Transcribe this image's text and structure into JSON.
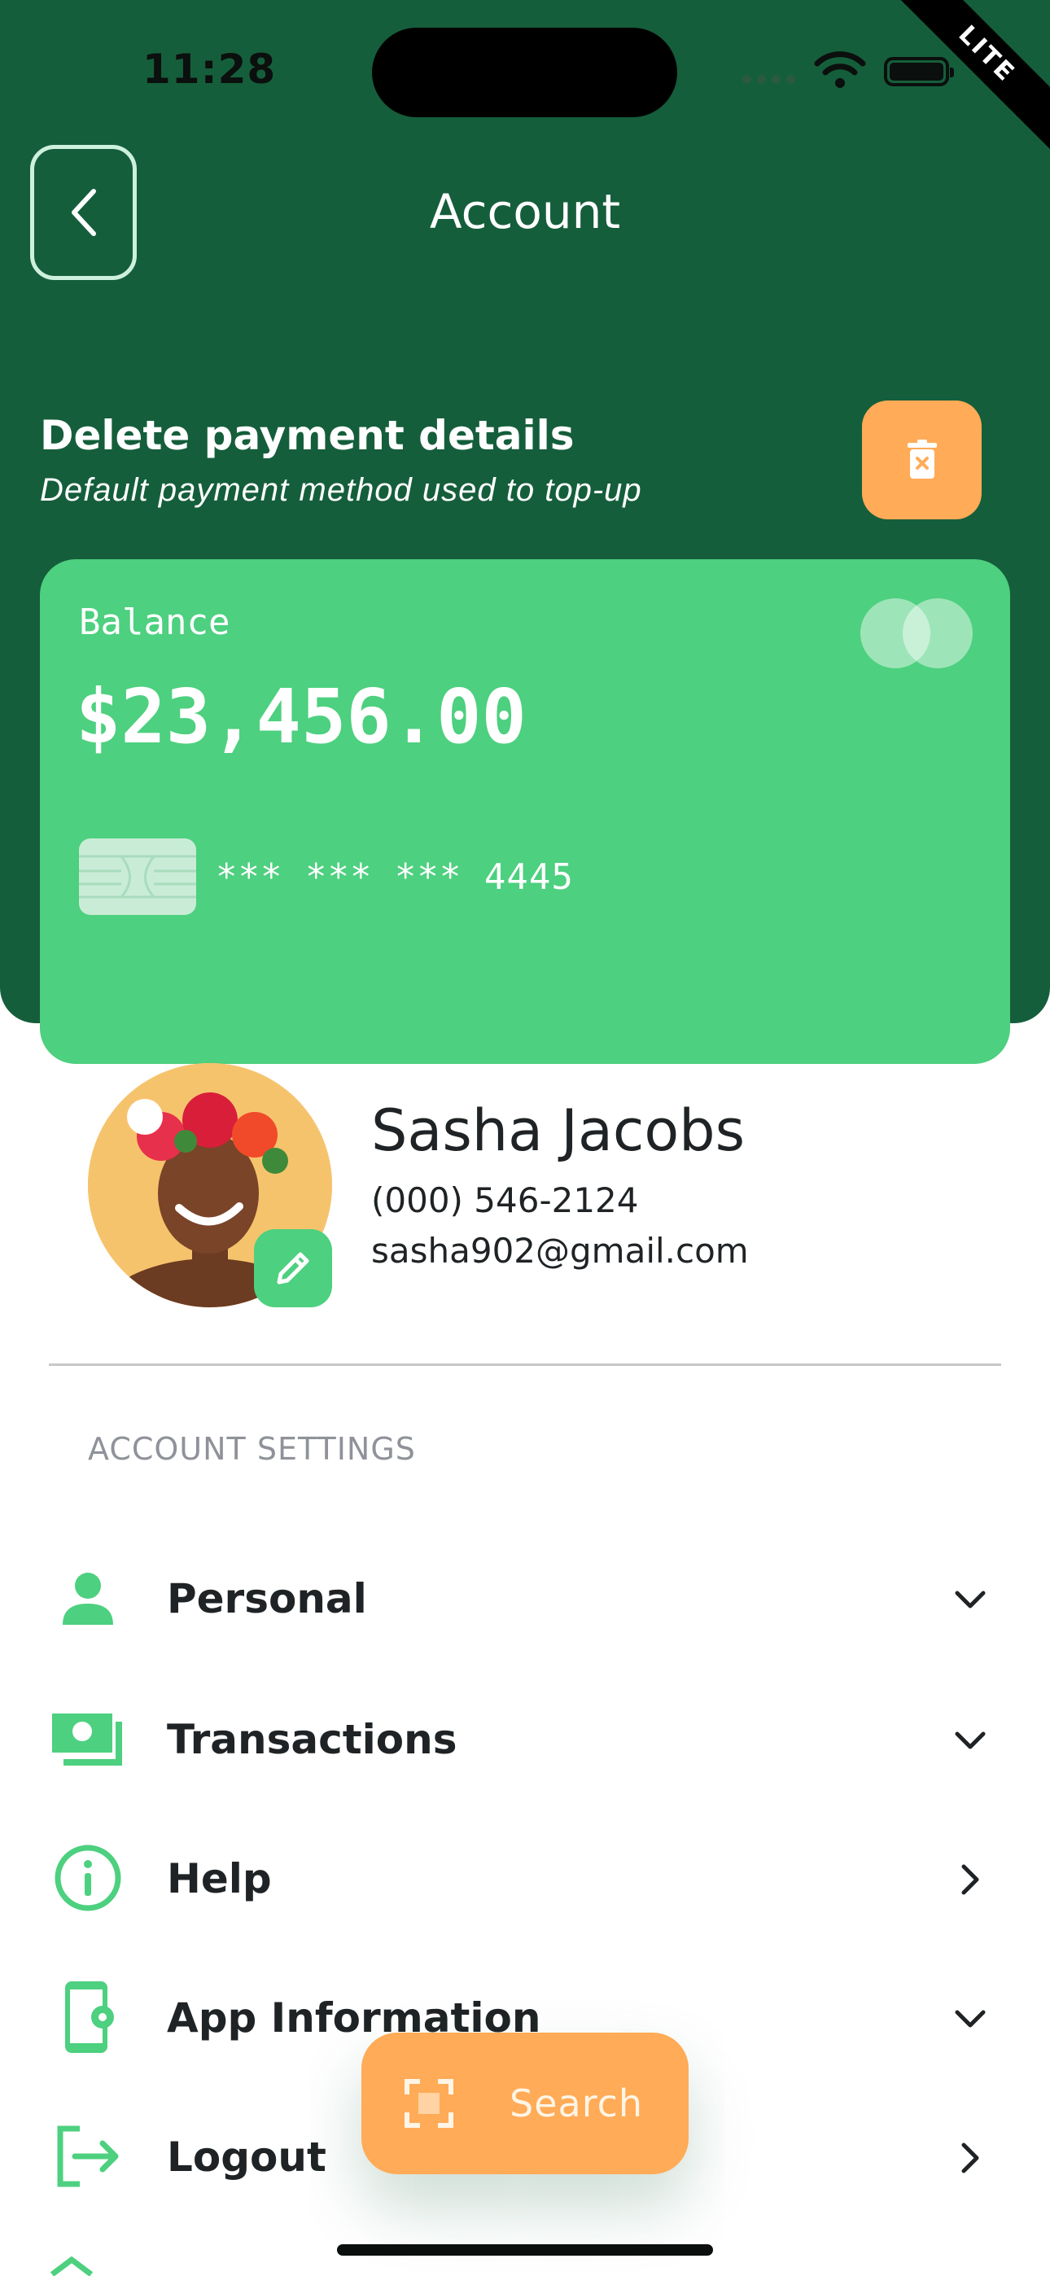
{
  "status_bar": {
    "time": "11:28"
  },
  "badge": {
    "label": "LITE"
  },
  "header": {
    "title": "Account"
  },
  "payment": {
    "title": "Delete payment details",
    "subtitle": "Default payment method used to top-up"
  },
  "card": {
    "balance_label": "Balance",
    "balance_value": "$23,456.00",
    "masked_number": "*** *** *** 4445"
  },
  "profile": {
    "name": "Sasha Jacobs",
    "phone": "(000) 546-2124",
    "email": "sasha902@gmail.com"
  },
  "settings": {
    "section_label": "ACCOUNT SETTINGS",
    "items": [
      {
        "label": "Personal",
        "icon": "person-icon",
        "chevron": "chevron-down-icon"
      },
      {
        "label": "Transactions",
        "icon": "money-icon",
        "chevron": "chevron-down-icon"
      },
      {
        "label": "Help",
        "icon": "info-icon",
        "chevron": "chevron-right-icon"
      },
      {
        "label": "App Information",
        "icon": "phone-settings-icon",
        "chevron": "chevron-down-icon"
      },
      {
        "label": "Logout",
        "icon": "logout-icon",
        "chevron": "chevron-right-icon"
      }
    ]
  },
  "fab": {
    "label": "Search",
    "icon": "scan-icon"
  },
  "colors": {
    "header_bg": "#155e3b",
    "accent_green": "#4dd07f",
    "accent_orange": "#ffab57",
    "text_dark": "#1f2325",
    "muted": "#8f9299"
  }
}
